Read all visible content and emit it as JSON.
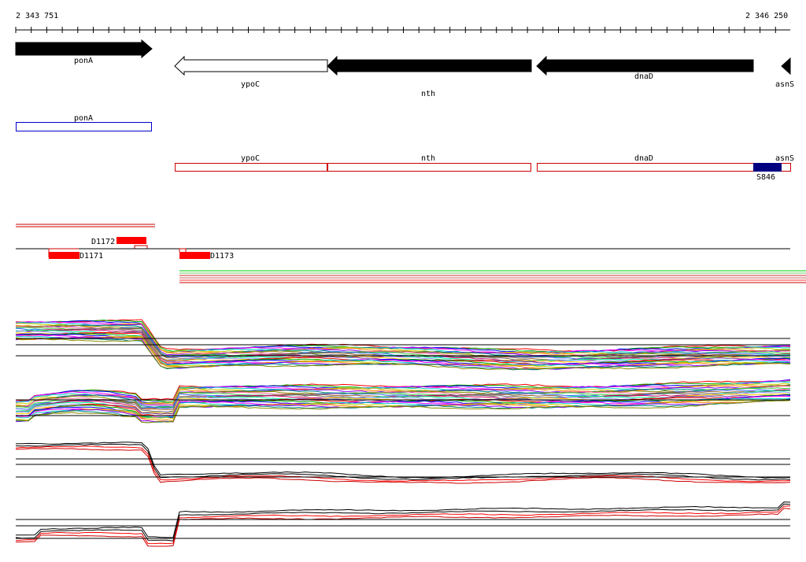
{
  "coords": {
    "start": "2 343 751",
    "end": "2 346 250"
  },
  "genes": [
    {
      "id": "ponA",
      "label": "ponA",
      "strand": "+",
      "fill": "black"
    },
    {
      "id": "ypoC",
      "label": "ypoC",
      "strand": "-",
      "fill": "white"
    },
    {
      "id": "nth",
      "label": "nth",
      "strand": "-",
      "fill": "black"
    },
    {
      "id": "dnaD",
      "label": "dnaD",
      "strand": "-",
      "fill": "black"
    },
    {
      "id": "asnS",
      "label": "asnS",
      "strand": "-",
      "fill": "black"
    }
  ],
  "transcripts_top": [
    {
      "id": "ponA",
      "label": "ponA",
      "color": "#0000cc"
    }
  ],
  "transcripts_bottom": [
    {
      "id": "ypoC",
      "label": "ypoC",
      "color": "#cc0000"
    },
    {
      "id": "nth",
      "label": "nth",
      "color": "#cc0000"
    },
    {
      "id": "dnaD",
      "label": "dnaD",
      "color": "#cc0000"
    },
    {
      "id": "asnS",
      "label": "asnS",
      "color": "#cc0000"
    }
  ],
  "site": {
    "label": "S846",
    "color": "#000080"
  },
  "features": [
    {
      "id": "D1172",
      "label": "D1172",
      "color": "#ff0000"
    },
    {
      "id": "D1171",
      "label": "D1171",
      "color": "#ff0000"
    },
    {
      "id": "D1173",
      "label": "D1173",
      "color": "#ff0000"
    }
  ],
  "colors": {
    "accent_red": "#ff0000",
    "blue": "#0000cc",
    "navy": "#000080",
    "green": "#00cc00"
  }
}
